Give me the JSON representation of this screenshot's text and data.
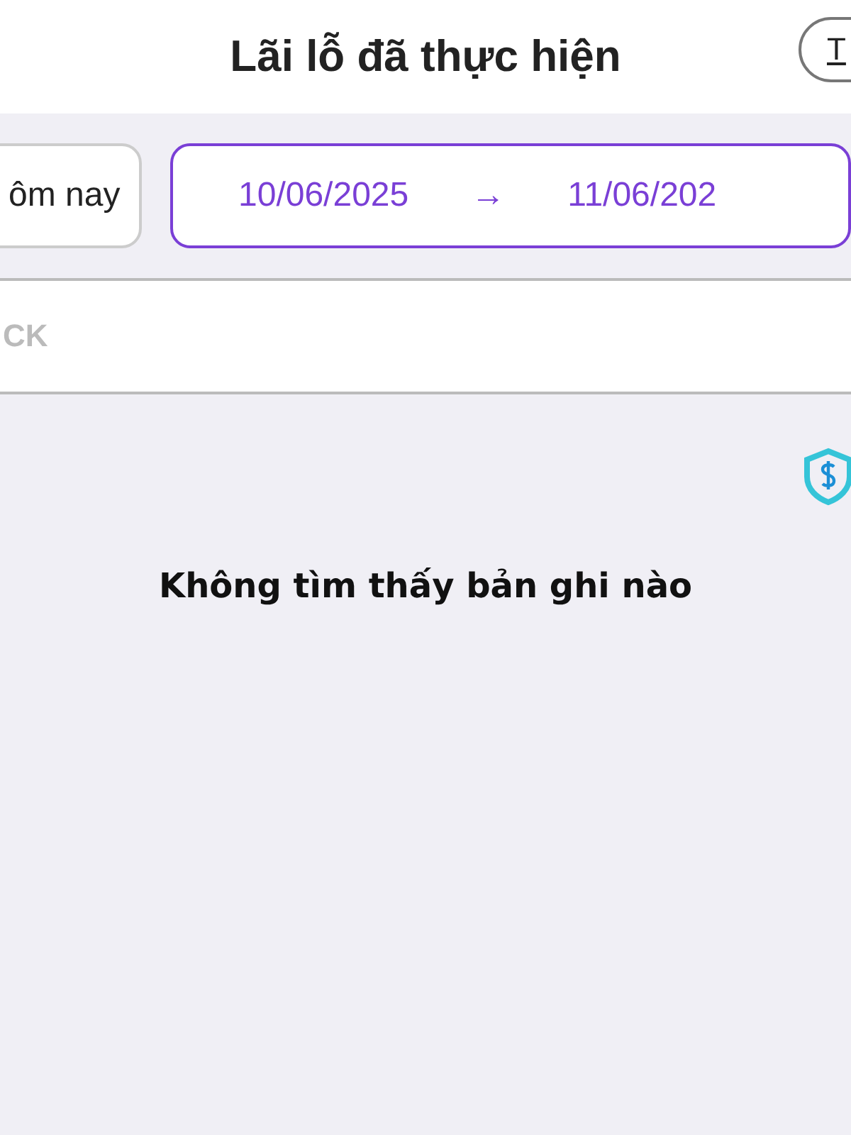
{
  "header": {
    "title": "Lãi lỗ đã thực hiện",
    "action_button": "T"
  },
  "filters": {
    "period": "ôm nay",
    "date_from": "10/06/2025",
    "arrow": "→",
    "date_to": "11/06/202"
  },
  "search": {
    "placeholder": "CK"
  },
  "empty_message": "Không tìm thấy bản ghi nào"
}
